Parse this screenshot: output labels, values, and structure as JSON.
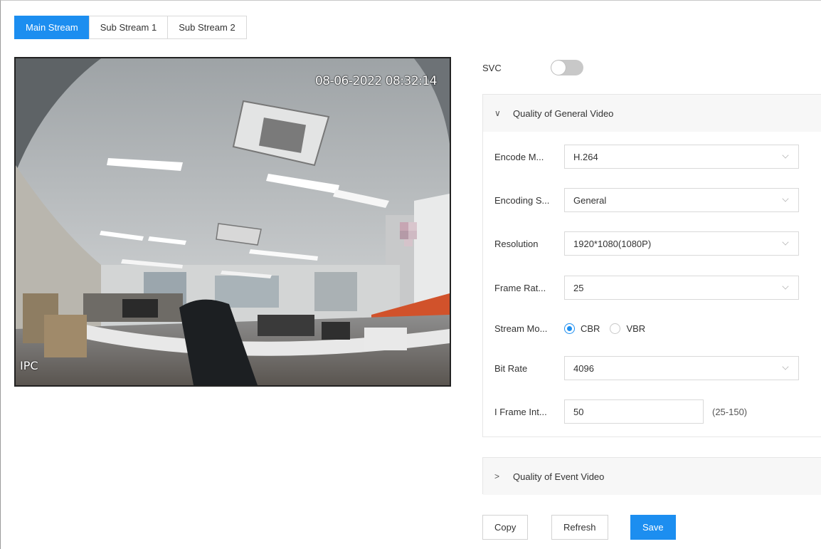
{
  "tabs": [
    {
      "label": "Main Stream",
      "active": true
    },
    {
      "label": "Sub Stream 1",
      "active": false
    },
    {
      "label": "Sub Stream 2",
      "active": false
    }
  ],
  "preview": {
    "timestamp": "08-06-2022 08:32:14",
    "channel_label": "IPC"
  },
  "svc": {
    "label": "SVC",
    "enabled": false
  },
  "general_section": {
    "title": "Quality of General Video",
    "expanded": true,
    "fields": {
      "encode_mode": {
        "label": "Encode M...",
        "value": "H.264"
      },
      "encoding_strategy": {
        "label": "Encoding S...",
        "value": "General"
      },
      "resolution": {
        "label": "Resolution",
        "value": "1920*1080(1080P)"
      },
      "frame_rate": {
        "label": "Frame Rat...",
        "value": "25"
      },
      "stream_mode": {
        "label": "Stream Mo...",
        "options": [
          "CBR",
          "VBR"
        ],
        "selected": "CBR"
      },
      "bit_rate": {
        "label": "Bit Rate",
        "value": "4096"
      },
      "i_frame_interval": {
        "label": "I Frame Int...",
        "value": "50",
        "range": "(25-150)"
      }
    }
  },
  "event_section": {
    "title": "Quality of Event Video",
    "expanded": false
  },
  "buttons": {
    "copy": "Copy",
    "refresh": "Refresh",
    "save": "Save"
  },
  "colors": {
    "accent": "#1c8ef0",
    "border": "#d9d9d9",
    "section_bg": "#f7f7f7"
  }
}
